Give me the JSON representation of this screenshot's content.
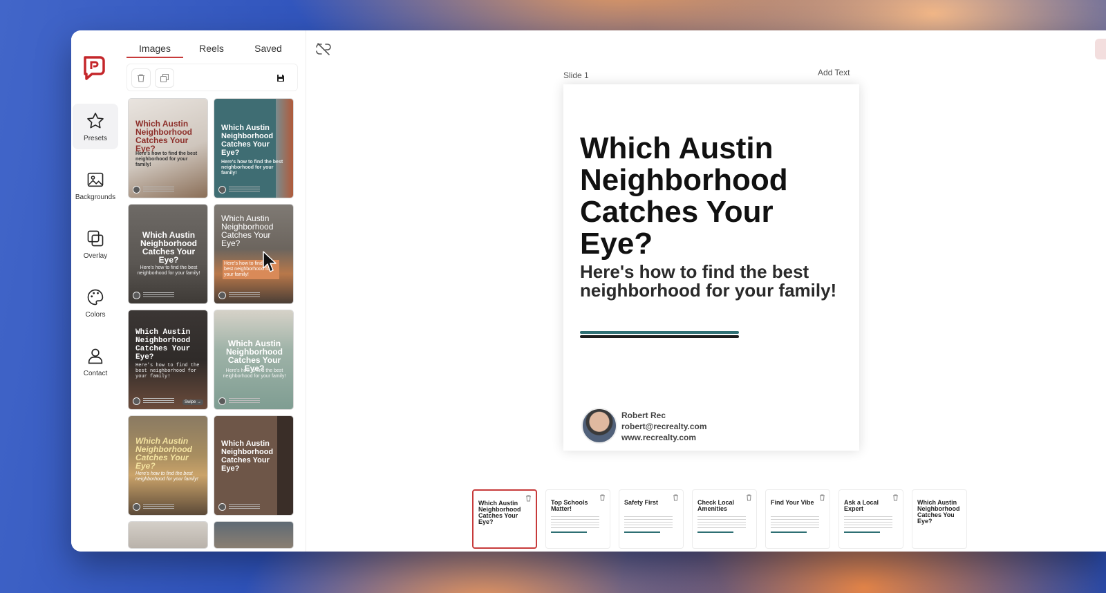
{
  "rail": {
    "items": [
      {
        "label": "Presets",
        "icon": "star-icon"
      },
      {
        "label": "Backgrounds",
        "icon": "image-icon"
      },
      {
        "label": "Overlay",
        "icon": "layers-icon"
      },
      {
        "label": "Colors",
        "icon": "palette-icon"
      },
      {
        "label": "Contact",
        "icon": "user-icon"
      }
    ]
  },
  "gallery": {
    "tabs": [
      {
        "label": "Images"
      },
      {
        "label": "Reels"
      },
      {
        "label": "Saved"
      }
    ],
    "thumbs": [
      {
        "title": "Which Austin Neighborhood Catches Your Eye?",
        "subtitle": "Here's how to find the best neighborhood for your family!"
      },
      {
        "title": "Which Austin Neighborhood Catches Your Eye?",
        "subtitle": "Here's how to find the best neighborhood for your family!"
      },
      {
        "title": "Which Austin Neighborhood Catches Your Eye?",
        "subtitle": "Here's how to find the best neighborhood for your family!"
      },
      {
        "title": "Which Austin Neighborhood Catches Your Eye?",
        "subtitle": "Here's how to find the best neighborhood for your family!"
      },
      {
        "title": "Which Austin Neighborhood Catches Your Eye?",
        "subtitle": "Here's how to find the best neighborhood for your family!"
      },
      {
        "title": "Which Austin Neighborhood Catches Your Eye?",
        "subtitle": "Here's how to find the best neighborhood for your family!"
      },
      {
        "title": "Which Austin Neighborhood Catches Your Eye?",
        "subtitle": "Here's how to find the best neighborhood for your family!"
      },
      {
        "title": "Which Austin Neighborhood Catches Your Eye?",
        "subtitle": ""
      }
    ],
    "swipe_label": "Swipe →"
  },
  "canvas": {
    "slide_label": "Slide 1",
    "add_text_label": "Add Text",
    "slide": {
      "title": "Which Austin Neighborhood Catches Your Eye?",
      "subtitle": "Here's how to find the best neighborhood for your family!",
      "contact_name": "Robert Rec",
      "contact_email": "robert@recrealty.com",
      "contact_web": "www.recrealty.com"
    },
    "filmstrip": [
      {
        "title": "Which Austin Neighborhood Catches Your Eye?"
      },
      {
        "title": "Top Schools Matter!"
      },
      {
        "title": "Safety First"
      },
      {
        "title": "Check Local Amenities"
      },
      {
        "title": "Find Your Vibe"
      },
      {
        "title": "Ask a Local Expert"
      },
      {
        "title": "Which Austin Neighborhood Catches You Eye?"
      }
    ]
  },
  "colors": {
    "accent": "#c73a3a",
    "teal": "#2e6f73"
  }
}
